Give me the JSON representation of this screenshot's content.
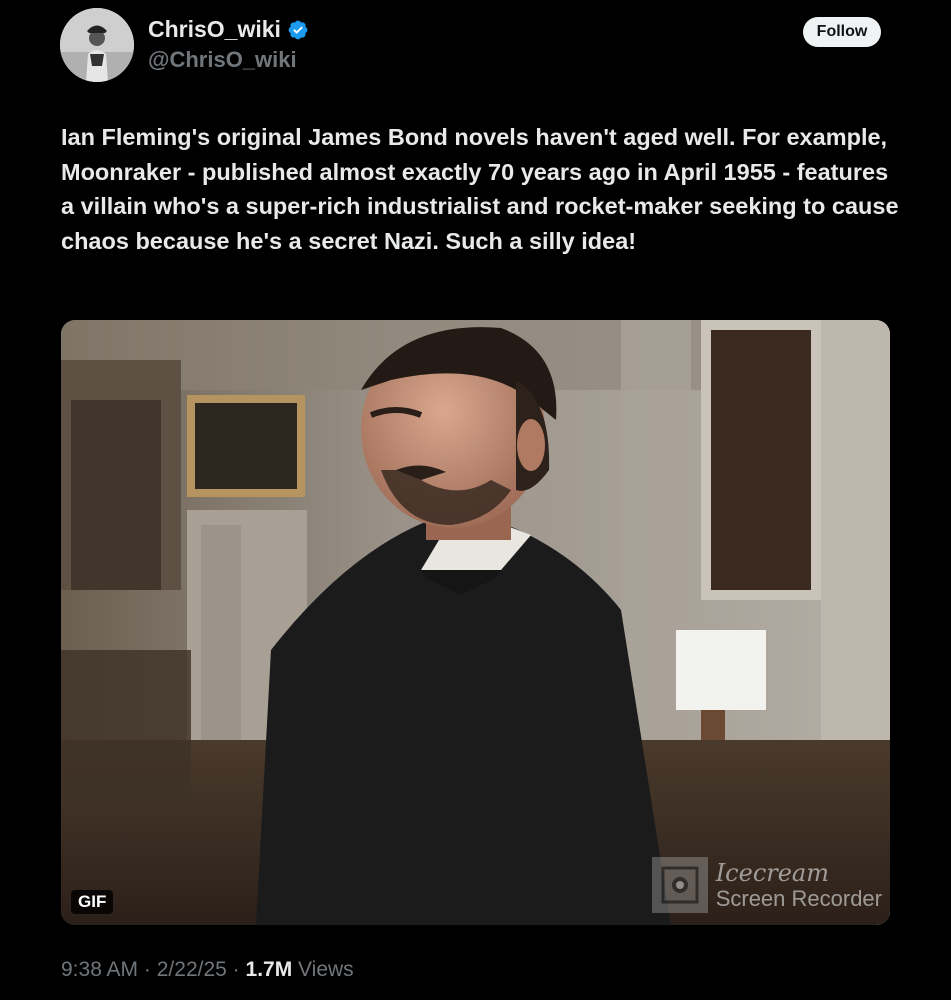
{
  "author": {
    "display_name": "ChrisO_wiki",
    "handle": "@ChrisO_wiki",
    "verified": true,
    "avatar_icon": "profile-photo"
  },
  "follow_button": {
    "label": "Follow"
  },
  "tweet": {
    "text": "Ian Fleming's original James Bond novels haven't aged well. For example, Moonraker - published almost exactly 70 years ago in April 1955 - features a villain who's a super-rich industrialist and rocket-maker seeking to cause chaos because he's a secret Nazi. Such a silly idea!"
  },
  "media": {
    "type": "gif",
    "badge": "GIF",
    "watermark": {
      "brand": "Icecream",
      "product": "Screen Recorder"
    }
  },
  "meta": {
    "time": "9:38 AM",
    "separator": "·",
    "date": "2/22/25",
    "views_count": "1.7M",
    "views_label": "Views"
  },
  "colors": {
    "background": "#000000",
    "text_primary": "#e7e9ea",
    "text_secondary": "#71767b",
    "verified_blue": "#1d9bf0",
    "follow_bg": "#eff3f4"
  }
}
